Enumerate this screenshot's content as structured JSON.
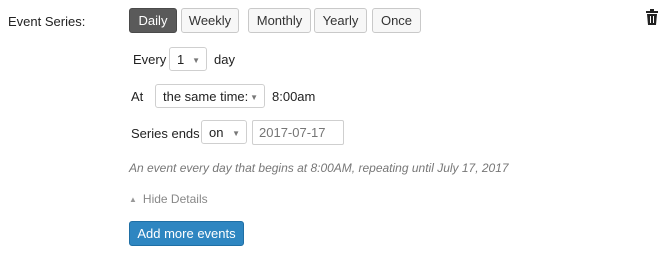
{
  "event_series": {
    "label": "Event Series:",
    "frequencies": [
      "Daily",
      "Weekly",
      "Monthly",
      "Yearly",
      "Once"
    ],
    "selected": "Daily"
  },
  "every": {
    "label": "Every",
    "value": "1",
    "unit": "day"
  },
  "at": {
    "label": "At",
    "mode": "the same time:",
    "time": "8:00am"
  },
  "series_ends": {
    "label": "Series ends",
    "mode": "on",
    "date_placeholder": "2017-07-17"
  },
  "summary": "An event every day that begins at 8:00AM, repeating until July 17, 2017",
  "details_toggle": "Hide Details",
  "add_more_button": "Add more events",
  "icons": {
    "delete": "trash-icon",
    "dropdown": "chevron-down-icon",
    "toggle": "triangle-up-icon"
  }
}
